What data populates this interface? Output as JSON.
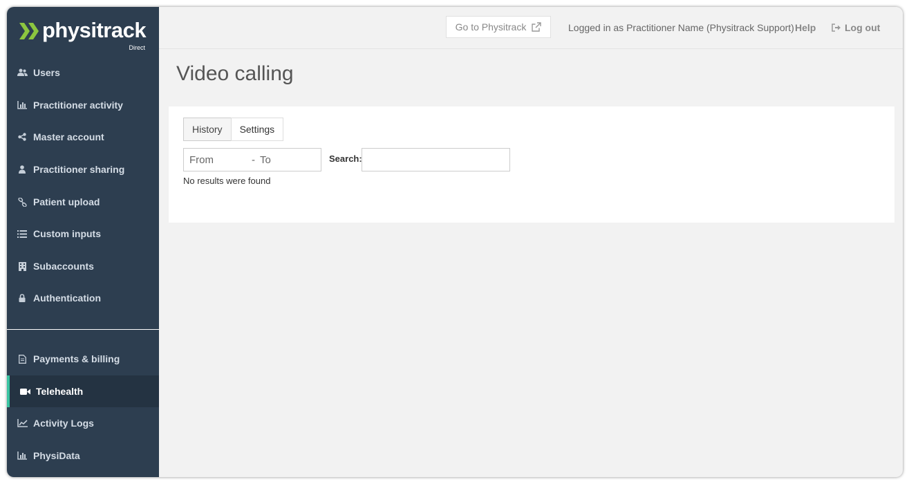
{
  "brand": {
    "name": "physitrack",
    "sub": "Direct",
    "accent": "#8cc63f",
    "sidebar_bg": "#2d3e50",
    "active_indicator": "#3ac4a2"
  },
  "sidebar": {
    "items": [
      {
        "label": "Users",
        "icon": "users-icon"
      },
      {
        "label": "Practitioner activity",
        "icon": "bar-chart-icon"
      },
      {
        "label": "Master account",
        "icon": "share-icon"
      },
      {
        "label": "Practitioner sharing",
        "icon": "user-icon"
      },
      {
        "label": "Patient upload",
        "icon": "link-icon"
      },
      {
        "label": "Custom inputs",
        "icon": "list-icon"
      },
      {
        "label": "Subaccounts",
        "icon": "building-icon"
      },
      {
        "label": "Authentication",
        "icon": "lock-icon"
      }
    ],
    "bottom_items": [
      {
        "label": "Payments & billing",
        "icon": "document-icon"
      },
      {
        "label": "Telehealth",
        "icon": "video-icon",
        "active": true
      },
      {
        "label": "Activity Logs",
        "icon": "line-chart-icon"
      },
      {
        "label": "PhysiData",
        "icon": "bar-chart-icon"
      }
    ]
  },
  "topbar": {
    "go_to": "Go to Physitrack",
    "logged_in": "Logged in as Practitioner Name (Physitrack Support)",
    "help": "Help",
    "logout": "Log out"
  },
  "page": {
    "title": "Video calling",
    "tabs": [
      {
        "label": "History",
        "active": true
      },
      {
        "label": "Settings",
        "active": false
      }
    ],
    "date_from": "From",
    "date_sep": "-",
    "date_to": "To",
    "search_label": "Search:",
    "search_value": "",
    "no_results": "No results were found"
  }
}
